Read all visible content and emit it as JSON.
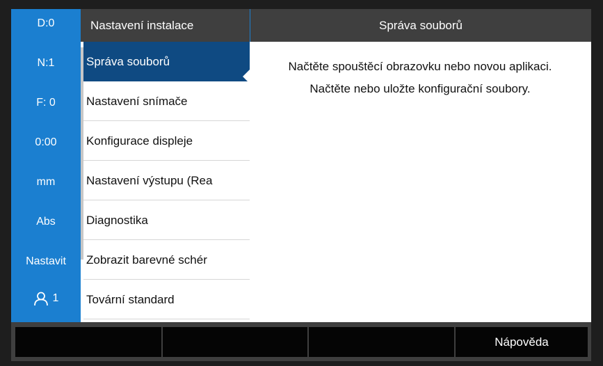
{
  "status_bar": {
    "items": [
      "D:0",
      "N:1",
      "F:  0",
      "0:00",
      "mm",
      "Abs",
      "Nastavit"
    ],
    "user_icon": "user-icon",
    "user_number": "1"
  },
  "menu": {
    "title": "Nastavení instalace",
    "items": [
      "Správa souborů",
      "Nastavení snímače",
      "Konfigurace displeje",
      "Nastavení výstupu (Rea",
      "Diagnostika",
      "Zobrazit barevné schér",
      "Tovární standard"
    ],
    "selected_index": 0
  },
  "content": {
    "title": "Správa souborů",
    "description": "Načtěte spouštěcí obrazovku nebo novou aplikaci.  Načtěte nebo uložte konfigurační soubory."
  },
  "softkeys": [
    "",
    "",
    "",
    "Nápověda"
  ],
  "colors": {
    "status_bar": "#1b7fd0",
    "selected_item": "#0f4a82",
    "header": "#3f3f3f",
    "softkey": "#050505"
  }
}
